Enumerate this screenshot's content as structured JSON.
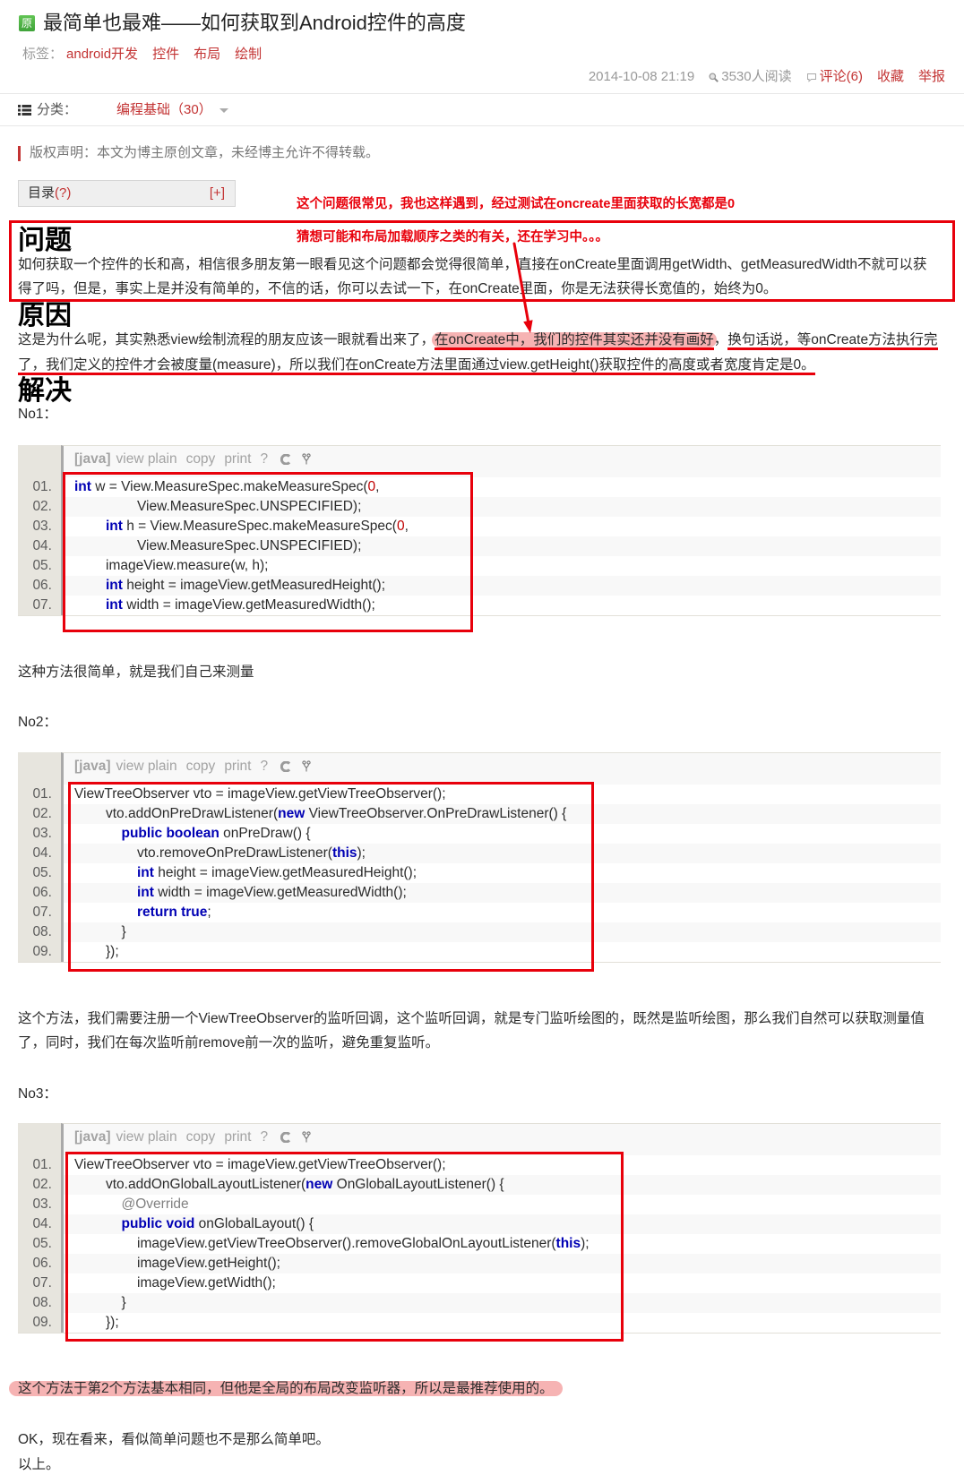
{
  "colors": {
    "tag_red": "#c33333",
    "markup_red": "#e8000b",
    "highlight_pink": "#f6b3b3",
    "keyword_blue": "#0000b4",
    "number_red": "#c00000",
    "badge_green": "#3fa33a"
  },
  "header": {
    "badge": "原",
    "title": "最简单也最难——如何获取到Android控件的高度",
    "tags_label": "标签：",
    "tags": [
      "android开发",
      "控件",
      "布局",
      "绘制"
    ],
    "meta": {
      "date": "2014-10-08 21:19",
      "views": "3530人阅读",
      "comments": "评论(6)",
      "favorite": "收藏",
      "report": "举报"
    },
    "category": {
      "label": "分类：",
      "value": "编程基础（30）"
    }
  },
  "copyright": "版权声明：本文为博主原创文章，未经博主允许不得转载。",
  "toc": {
    "label": "目录",
    "help": "(?)",
    "toggle": "[+]"
  },
  "annotations": {
    "note1": "这个问题很常见，我也这样遇到，经过测试在oncreate里面获取的长宽都是0",
    "note2": "猜想可能和布局加载顺序之类的有关，还在学习中。。。"
  },
  "problem": {
    "heading": "问题",
    "lines": [
      "如何获取一个控件的长和高，相信很多朋友第一眼看见这个问题都会觉得很简单，直接在onCreate里面调用getWidth、getMeasuredWidth不就可以获",
      "得了吗，但是，事实上是并没有简单的，不信的话，你可以去试一下，在onCreate里面，你是无法获得长宽值的，始终为0。"
    ]
  },
  "reason": {
    "heading": "原因",
    "line1_lead": "这是为什么呢，其实熟悉view绘制流程的朋友应该一眼就看出来了，",
    "line1_highlight": "在onCreate中，我们的控件其实还并没有画好",
    "line1_sep": "，",
    "line1_underlined": "换句话说，等onCreate方法执行完",
    "line2": "了，我们定义的控件才会被度量(measure)，所以我们在onCreate方法里面通过view.getHeight()获取控件的高度或者宽度肯定是0。"
  },
  "solution": {
    "heading": "解决",
    "no1_label": "No1：",
    "no1_note": "这种方法很简单，就是我们自己来测量",
    "no2_label": "No2：",
    "no2_note_lines": [
      "这个方法，我们需要注册一个ViewTreeObserver的监听回调，这个监听回调，就是专门监听绘图的，既然是监听绘图，那么我们自然可以获取测量值",
      "了，同时，我们在每次监听前remove前一次的监听，避免重复监听。"
    ],
    "no3_label": "No3：",
    "no3_note": "这个方法于第2个方法基本相同，但他是全局的布局改变监听器，所以是最推荐使用的。",
    "closing": "OK，现在看来，看似简单问题也不是那么简单吧。",
    "end": "以上。"
  },
  "code_toolbar": {
    "lang": "[java]",
    "view_plain": "view plain",
    "copy": "copy",
    "print": "print",
    "help": "?"
  },
  "code_blocks": [
    {
      "language": "java",
      "lines": [
        {
          "n": "01.",
          "indent": 0,
          "tokens": [
            [
              "kw",
              "int"
            ],
            [
              "p",
              " w = View.MeasureSpec.makeMeasureSpec("
            ],
            [
              "num",
              "0"
            ],
            [
              "p",
              ","
            ]
          ]
        },
        {
          "n": "02.",
          "indent": 4,
          "tokens": [
            [
              "p",
              "View.MeasureSpec.UNSPECIFIED);"
            ]
          ]
        },
        {
          "n": "03.",
          "indent": 2,
          "tokens": [
            [
              "kw",
              "int"
            ],
            [
              "p",
              " h = View.MeasureSpec.makeMeasureSpec("
            ],
            [
              "num",
              "0"
            ],
            [
              "p",
              ","
            ]
          ]
        },
        {
          "n": "04.",
          "indent": 4,
          "tokens": [
            [
              "p",
              "View.MeasureSpec.UNSPECIFIED);"
            ]
          ]
        },
        {
          "n": "05.",
          "indent": 2,
          "tokens": [
            [
              "p",
              "imageView.measure(w, h);"
            ]
          ]
        },
        {
          "n": "06.",
          "indent": 2,
          "tokens": [
            [
              "kw",
              "int"
            ],
            [
              "p",
              " height = imageView.getMeasuredHeight();"
            ]
          ]
        },
        {
          "n": "07.",
          "indent": 2,
          "tokens": [
            [
              "kw",
              "int"
            ],
            [
              "p",
              " width = imageView.getMeasuredWidth();"
            ]
          ]
        }
      ]
    },
    {
      "language": "java",
      "lines": [
        {
          "n": "01.",
          "indent": 0,
          "tokens": [
            [
              "p",
              "ViewTreeObserver vto = imageView.getViewTreeObserver();"
            ]
          ]
        },
        {
          "n": "02.",
          "indent": 2,
          "tokens": [
            [
              "p",
              "vto.addOnPreDrawListener("
            ],
            [
              "kw",
              "new"
            ],
            [
              "p",
              " ViewTreeObserver.OnPreDrawListener() {"
            ]
          ]
        },
        {
          "n": "03.",
          "indent": 3,
          "tokens": [
            [
              "kw",
              "public boolean"
            ],
            [
              "p",
              " onPreDraw() {"
            ]
          ]
        },
        {
          "n": "04.",
          "indent": 4,
          "tokens": [
            [
              "p",
              "vto.removeOnPreDrawListener("
            ],
            [
              "kw",
              "this"
            ],
            [
              "p",
              ");"
            ]
          ]
        },
        {
          "n": "05.",
          "indent": 4,
          "tokens": [
            [
              "kw",
              "int"
            ],
            [
              "p",
              " height = imageView.getMeasuredHeight();"
            ]
          ]
        },
        {
          "n": "06.",
          "indent": 4,
          "tokens": [
            [
              "kw",
              "int"
            ],
            [
              "p",
              " width = imageView.getMeasuredWidth();"
            ]
          ]
        },
        {
          "n": "07.",
          "indent": 4,
          "tokens": [
            [
              "kw",
              "return true"
            ],
            [
              "p",
              ";"
            ]
          ]
        },
        {
          "n": "08.",
          "indent": 3,
          "tokens": [
            [
              "p",
              "}"
            ]
          ]
        },
        {
          "n": "09.",
          "indent": 2,
          "tokens": [
            [
              "p",
              "});"
            ]
          ]
        }
      ]
    },
    {
      "language": "java",
      "lines": [
        {
          "n": "01.",
          "indent": 0,
          "tokens": [
            [
              "p",
              "ViewTreeObserver vto = imageView.getViewTreeObserver();"
            ]
          ]
        },
        {
          "n": "02.",
          "indent": 2,
          "tokens": [
            [
              "p",
              "vto.addOnGlobalLayoutListener("
            ],
            [
              "kw",
              "new"
            ],
            [
              "p",
              " OnGlobalLayoutListener() {"
            ]
          ]
        },
        {
          "n": "03.",
          "indent": 3,
          "tokens": [
            [
              "anno",
              "@Override"
            ]
          ]
        },
        {
          "n": "04.",
          "indent": 3,
          "tokens": [
            [
              "kw",
              "public void"
            ],
            [
              "p",
              " onGlobalLayout() {"
            ]
          ]
        },
        {
          "n": "05.",
          "indent": 4,
          "tokens": [
            [
              "p",
              "imageView.getViewTreeObserver().removeGlobalOnLayoutListener("
            ],
            [
              "kw",
              "this"
            ],
            [
              "p",
              ");"
            ]
          ]
        },
        {
          "n": "06.",
          "indent": 4,
          "tokens": [
            [
              "p",
              "imageView.getHeight();"
            ]
          ]
        },
        {
          "n": "07.",
          "indent": 4,
          "tokens": [
            [
              "p",
              "imageView.getWidth();"
            ]
          ]
        },
        {
          "n": "08.",
          "indent": 3,
          "tokens": [
            [
              "p",
              "}"
            ]
          ]
        },
        {
          "n": "09.",
          "indent": 2,
          "tokens": [
            [
              "p",
              "});"
            ]
          ]
        }
      ]
    }
  ]
}
